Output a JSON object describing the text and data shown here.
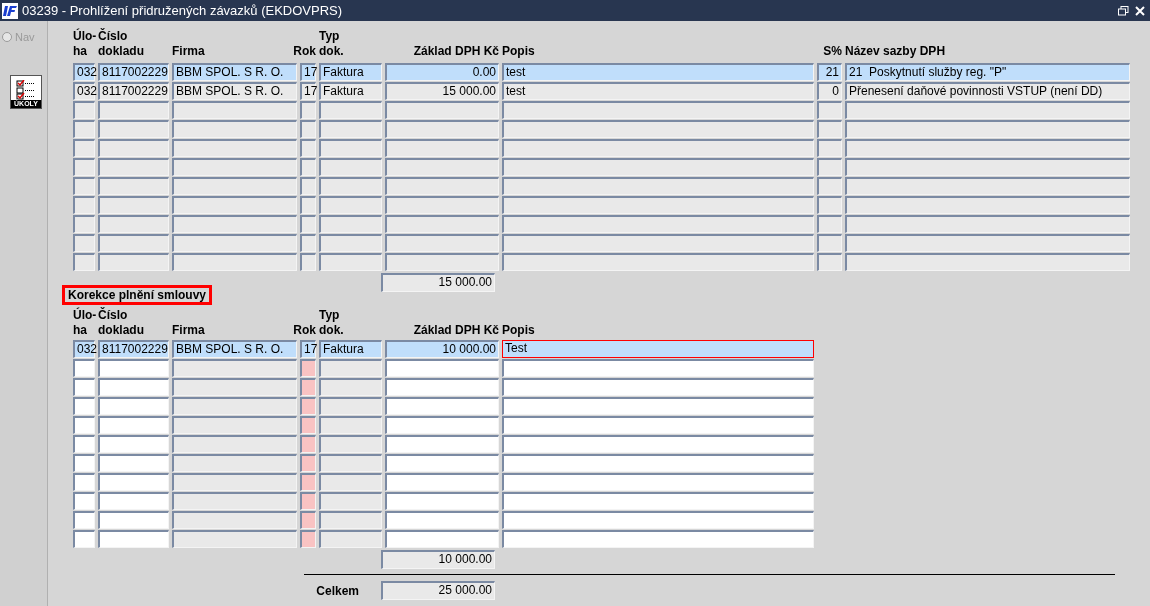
{
  "window": {
    "title": "03239 - Prohlížení přidružených závazků (EKDOVPRS)"
  },
  "sidebar": {
    "nav": {
      "label": "Nav",
      "selected": false,
      "disabled": true
    },
    "tasks_button": {
      "label": "ÚKOLY"
    }
  },
  "main_table": {
    "columns": [
      {
        "top": "Úlo-",
        "bottom": "ha"
      },
      {
        "top": "Číslo",
        "bottom": "dokladu"
      },
      {
        "bottom": "Firma"
      },
      {
        "bottom": "Rok"
      },
      {
        "top": "Typ",
        "bottom": "dok."
      },
      {
        "bottom": "Základ DPH Kč"
      },
      {
        "bottom": "Popis"
      },
      {
        "bottom": "S%"
      },
      {
        "bottom": "Název sazby DPH"
      }
    ],
    "rows": [
      {
        "selected": true,
        "cells": [
          "032",
          "8117002229",
          "BBM SPOL. S R. O.",
          "17",
          "Faktura",
          "0.00",
          "test",
          "21",
          "21  Poskytnutí služby reg. \"P\""
        ]
      },
      {
        "selected": false,
        "cells": [
          "032",
          "8117002229",
          "BBM SPOL. S R. O.",
          "17",
          "Faktura",
          "15 000.00",
          "test",
          "0",
          "Přenesení daňové povinnosti VSTUP (není DD)"
        ]
      }
    ],
    "total": "15 000.00"
  },
  "correction_section": {
    "title": "Korekce plnění smlouvy"
  },
  "correction_table": {
    "columns": [
      {
        "top": "Úlo-",
        "bottom": "ha"
      },
      {
        "top": "Číslo",
        "bottom": "dokladu"
      },
      {
        "bottom": "Firma"
      },
      {
        "bottom": "Rok"
      },
      {
        "top": "Typ",
        "bottom": "dok."
      },
      {
        "bottom": "Základ DPH Kč"
      },
      {
        "bottom": "Popis"
      }
    ],
    "rows": [
      {
        "selected": true,
        "cells": [
          {
            "text": "032",
            "focused": false
          },
          {
            "text": "8117002229",
            "focused": false
          },
          {
            "text": "BBM SPOL. S R. O.",
            "focused": false
          },
          {
            "text": "17",
            "focused": false
          },
          {
            "text": "Faktura",
            "focused": false
          },
          {
            "text": "10 000.00",
            "focused": false
          },
          {
            "text": "Test",
            "focused": true
          }
        ]
      }
    ],
    "total": "10 000.00"
  },
  "grand_total": {
    "label": "Celkem",
    "value": "25 000.00"
  }
}
